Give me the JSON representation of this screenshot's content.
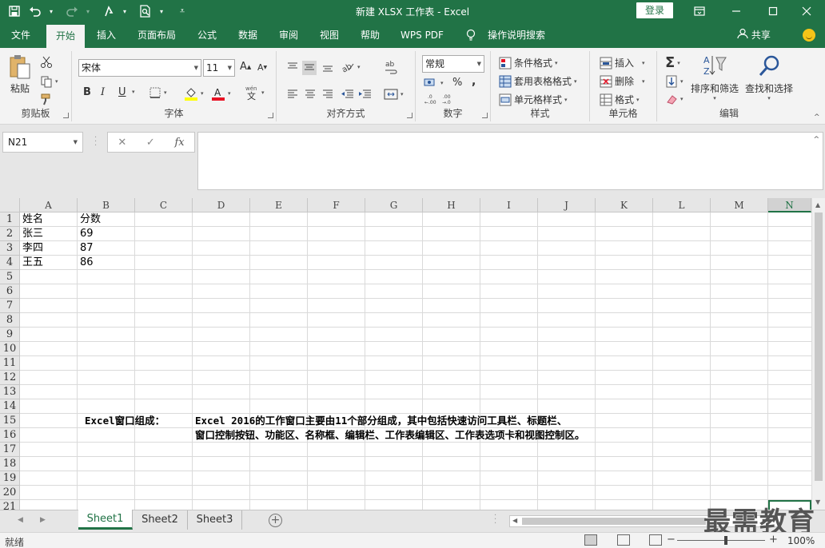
{
  "window": {
    "title": "新建 XLSX 工作表  -  Excel",
    "login": "登录",
    "colors": {
      "brand": "#217346",
      "ribbon": "#f3f3f3"
    }
  },
  "qat": {
    "icons": [
      "save-icon",
      "undo-icon",
      "redo-icon",
      "touch-mode-icon",
      "print-preview-icon",
      "customize-qat-icon"
    ]
  },
  "tabs": [
    {
      "label": "文件"
    },
    {
      "label": "开始",
      "active": true
    },
    {
      "label": "插入"
    },
    {
      "label": "页面布局"
    },
    {
      "label": "公式"
    },
    {
      "label": "数据"
    },
    {
      "label": "审阅"
    },
    {
      "label": "视图"
    },
    {
      "label": "帮助"
    },
    {
      "label": "WPS PDF"
    },
    {
      "label": "操作说明搜索"
    }
  ],
  "share": "共享",
  "ribbon": {
    "clipboard": {
      "paste": "粘贴",
      "label": "剪贴板"
    },
    "font": {
      "name": "宋体",
      "size": "11",
      "bold": "B",
      "italic": "I",
      "underline": "U",
      "label": "字体"
    },
    "alignment": {
      "label": "对齐方式"
    },
    "number": {
      "format": "常规",
      "percent": "%",
      "comma": ",",
      "label": "数字"
    },
    "styles": {
      "conditional": "条件格式",
      "table": "套用表格格式",
      "cell": "单元格样式",
      "label": "样式"
    },
    "cells": {
      "insert": "插入",
      "delete": "删除",
      "format": "格式",
      "label": "单元格"
    },
    "editing": {
      "sort": "排序和筛选",
      "find": "查找和选择",
      "label": "编辑"
    }
  },
  "formula_bar": {
    "name_box": "N21",
    "fx": "fx",
    "value": ""
  },
  "grid": {
    "columns": [
      "A",
      "B",
      "C",
      "D",
      "E",
      "F",
      "G",
      "H",
      "I",
      "J",
      "K",
      "L",
      "M",
      "N"
    ],
    "selected_column": "N",
    "rows": [
      "1",
      "2",
      "3",
      "4",
      "5",
      "6",
      "7",
      "8",
      "9",
      "10",
      "11",
      "12",
      "13",
      "14",
      "15",
      "16",
      "17",
      "18",
      "19",
      "20",
      "21"
    ],
    "cells": {
      "A1": "姓名",
      "B1": "分数",
      "A2": "张三",
      "B2": "69",
      "A3": "李四",
      "B3": "87",
      "A4": "王五",
      "B4": "86"
    },
    "note_label": "Excel窗口组成：",
    "note_line1": "Excel 2016的工作窗口主要由11个部分组成，其中包括快速访问工具栏、标题栏、",
    "note_line2": "窗口控制按钮、功能区、名称框、编辑栏、工作表编辑区、工作表选项卡和视图控制区。"
  },
  "sheets": [
    {
      "label": "Sheet1",
      "active": true
    },
    {
      "label": "Sheet2"
    },
    {
      "label": "Sheet3"
    }
  ],
  "status": {
    "text": "就绪",
    "zoom": "100%"
  },
  "watermark": "最需教育"
}
